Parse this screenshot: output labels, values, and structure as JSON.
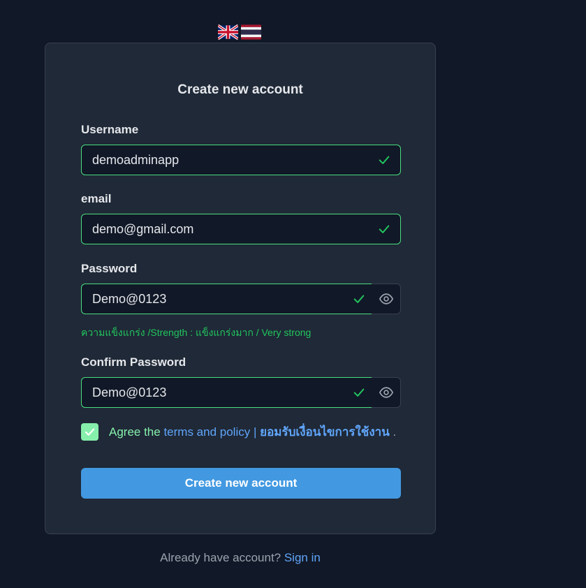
{
  "flags": [
    {
      "name": "English"
    },
    {
      "name": "Thai"
    }
  ],
  "form": {
    "title": "Create new account",
    "username": {
      "label": "Username",
      "value": "demoadminapp"
    },
    "email": {
      "label": "email",
      "value": "demo@gmail.com"
    },
    "password": {
      "label": "Password",
      "value": "Demo@0123"
    },
    "strength": "ความแข็งแกร่ง /Strength : แข็งแกร่งมาก / Very strong",
    "confirm_password": {
      "label": "Confirm Password",
      "value": "Demo@0123"
    },
    "agree": {
      "checked": true,
      "prefix": "Agree the ",
      "link_text": "terms and policy",
      "separator": " | ",
      "thai_link": "ยอมรับเงื่อนไขการใช้งาน",
      "suffix": " ."
    },
    "submit_label": "Create new account"
  },
  "footer": {
    "text": "Already have account? ",
    "link": "Sign in"
  },
  "colors": {
    "background": "#111827",
    "card": "#1f2937",
    "valid": "#4ade80",
    "link": "#60a5fa",
    "button": "#4299e1"
  }
}
